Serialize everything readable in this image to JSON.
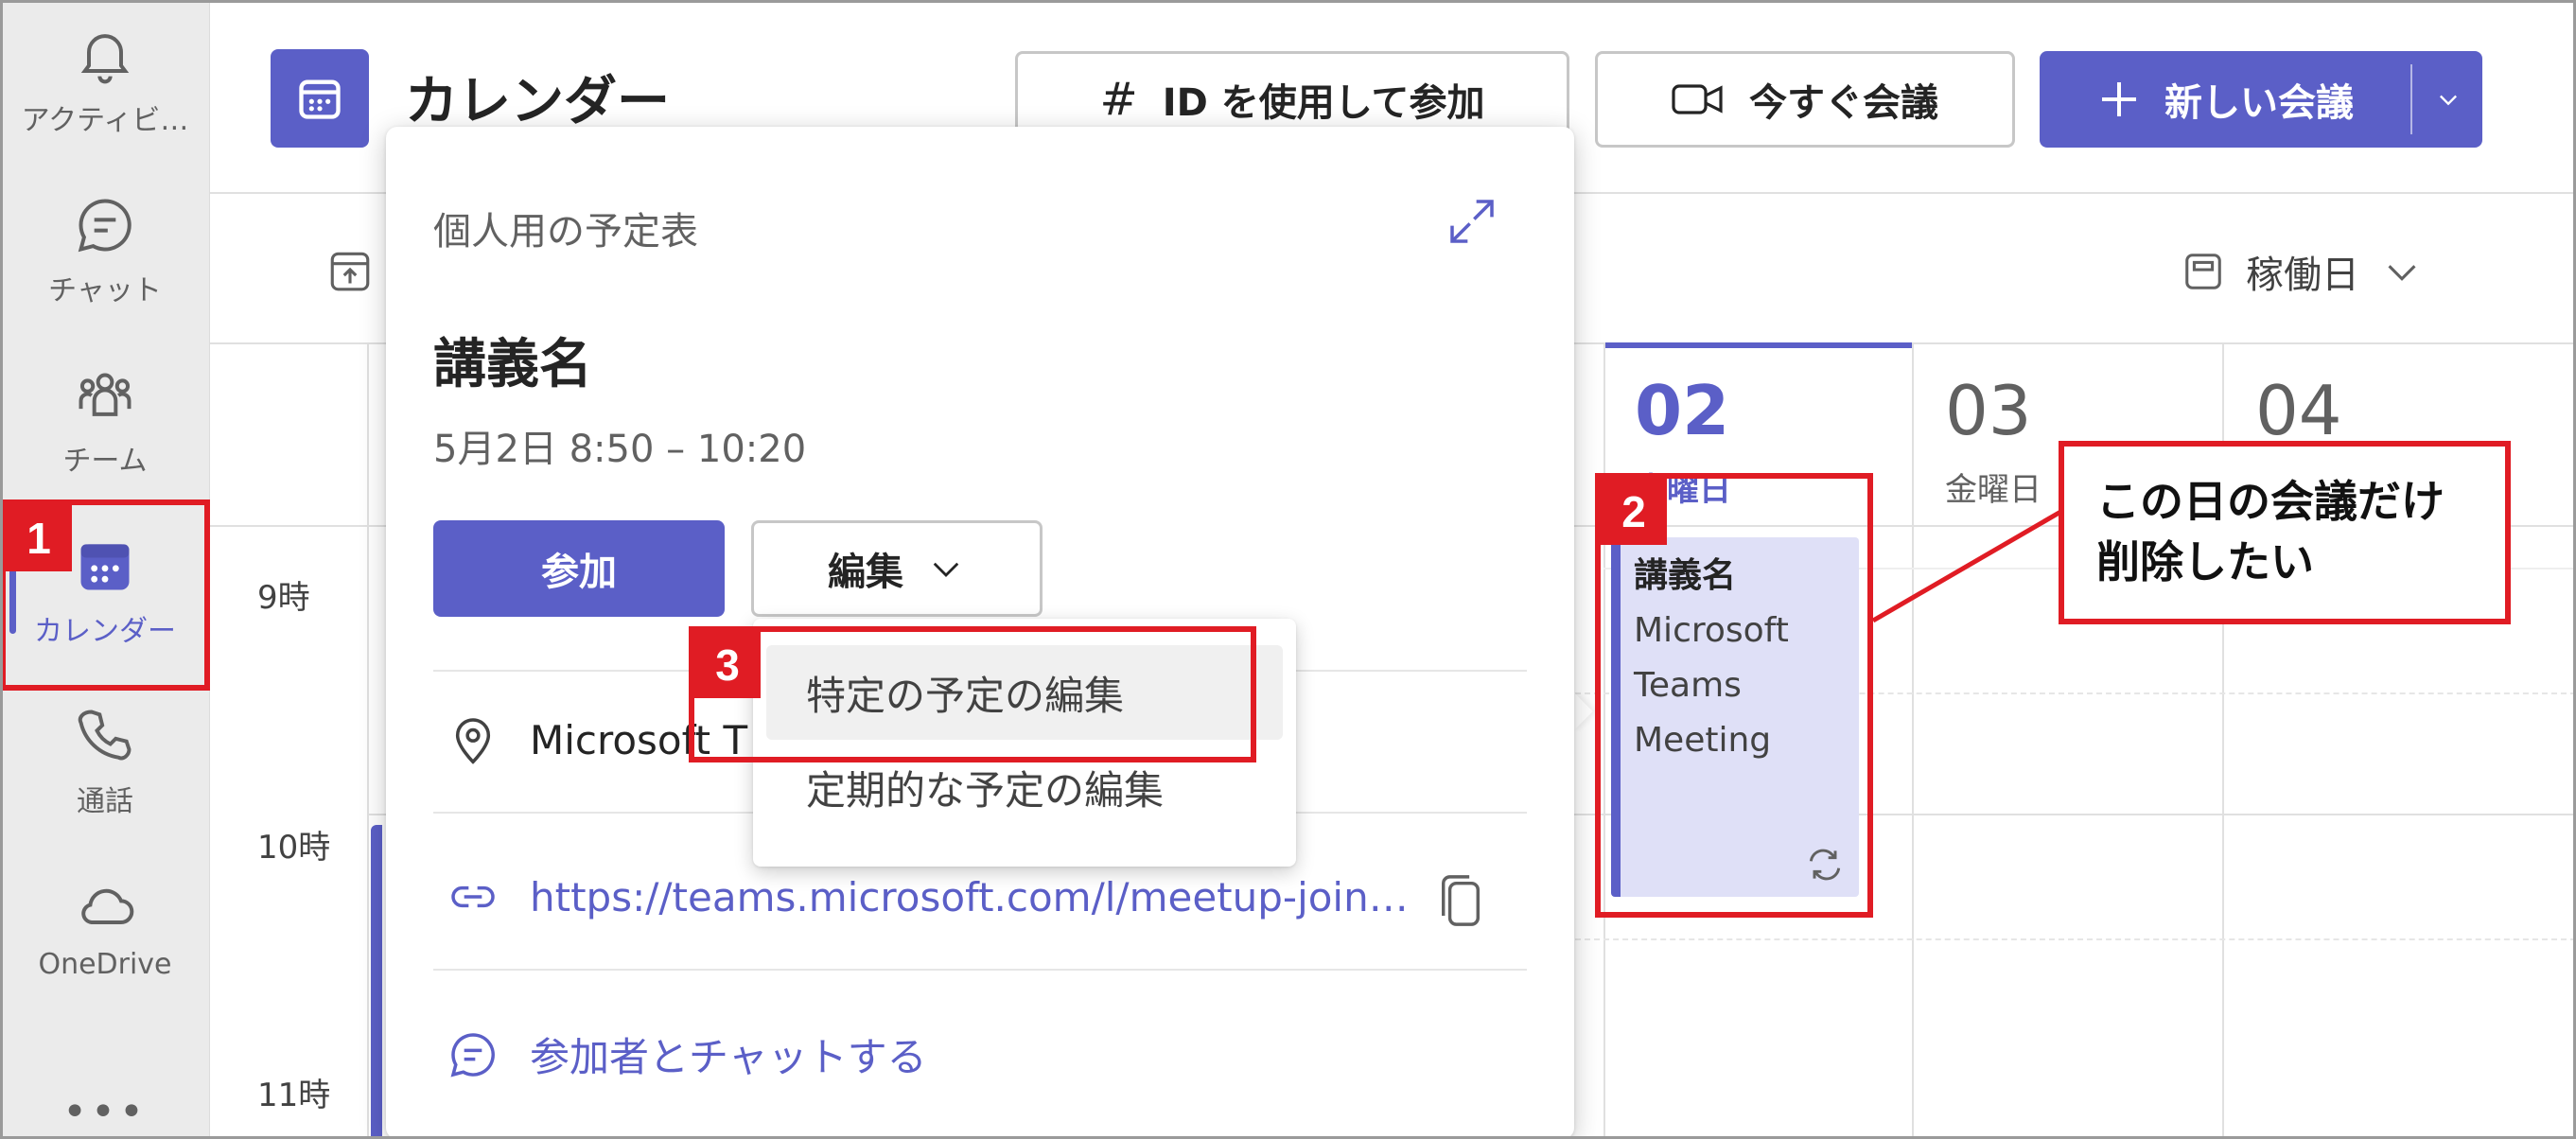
{
  "rail": {
    "items": [
      {
        "label": "アクティビ…",
        "icon": "bell-icon"
      },
      {
        "label": "チャット",
        "icon": "chat-icon"
      },
      {
        "label": "チーム",
        "icon": "teams-icon"
      },
      {
        "label": "カレンダー",
        "icon": "calendar-icon"
      },
      {
        "label": "通話",
        "icon": "phone-icon"
      },
      {
        "label": "OneDrive",
        "icon": "cloud-icon"
      }
    ],
    "more": "•••"
  },
  "header": {
    "title": "カレンダー",
    "join_with_id": "ID を使用して参加",
    "meet_now": "今すぐ会議",
    "new_meeting": "新しい会議"
  },
  "toolbar": {
    "view": "稼働日"
  },
  "calendar": {
    "times": [
      "9時",
      "10時",
      "11時"
    ],
    "days": [
      {
        "num": "02",
        "name": "木曜日"
      },
      {
        "num": "03",
        "name": "金曜日"
      },
      {
        "num": "04",
        "name": ""
      }
    ],
    "event": {
      "title": "講義名",
      "line1": "Microsoft",
      "line2": "Teams",
      "line3": "Meeting"
    }
  },
  "card": {
    "calendar_name": "個人用の予定表",
    "title": "講義名",
    "time": "5月2日 8:50 – 10:20",
    "join": "参加",
    "edit": "編集",
    "location": "Microsoft T",
    "link": "https://teams.microsoft.com/l/meetup-join…",
    "chat": "参加者とチャットする"
  },
  "menu": {
    "items": [
      "特定の予定の編集",
      "定期的な予定の編集"
    ]
  },
  "annotations": {
    "n1": "1",
    "n2": "2",
    "n3": "3",
    "callout_line1": "この日の会議だけ",
    "callout_line2": "削除したい",
    "color": "#e01c24"
  }
}
